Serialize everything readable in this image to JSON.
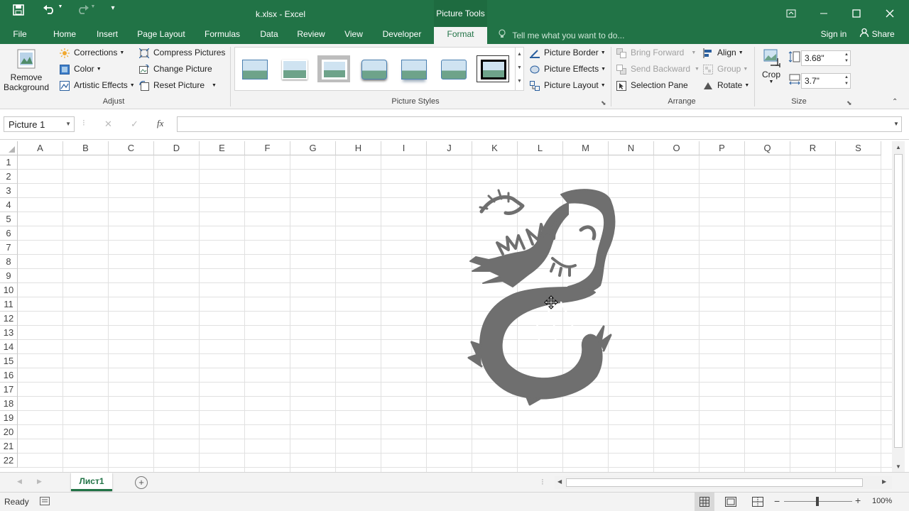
{
  "window": {
    "title": "k.xlsx - Excel",
    "context_tab_group": "Picture Tools",
    "undo_icon": "undo-icon",
    "redo_icon": "redo-icon"
  },
  "tabs": [
    "File",
    "Home",
    "Insert",
    "Page Layout",
    "Formulas",
    "Data",
    "Review",
    "View",
    "Developer",
    "Format"
  ],
  "active_tab": "Format",
  "tell_me": "Tell me what you want to do...",
  "sign_in": "Sign in",
  "share": "Share",
  "ribbon": {
    "remove_background": [
      "Remove",
      "Background"
    ],
    "corrections": "Corrections",
    "color": "Color",
    "artistic_effects": "Artistic Effects",
    "compress_pictures": "Compress Pictures",
    "change_picture": "Change Picture",
    "reset_picture": "Reset Picture",
    "adjust_label": "Adjust",
    "picture_styles_label": "Picture Styles",
    "picture_border": "Picture Border",
    "picture_effects": "Picture Effects",
    "picture_layout": "Picture Layout",
    "bring_forward": "Bring Forward",
    "send_backward": "Send Backward",
    "selection_pane": "Selection Pane",
    "align": "Align",
    "group": "Group",
    "rotate": "Rotate",
    "arrange_label": "Arrange",
    "crop": "Crop",
    "height": "3.68\"",
    "width": "3.7\"",
    "size_label": "Size"
  },
  "formula_bar": {
    "name_box": "Picture 1",
    "fx": "fx",
    "formula": ""
  },
  "columns": [
    "A",
    "B",
    "C",
    "D",
    "E",
    "F",
    "G",
    "H",
    "I",
    "J",
    "K",
    "L",
    "M",
    "N",
    "O",
    "P",
    "Q",
    "R",
    "S"
  ],
  "rows": [
    "1",
    "2",
    "3",
    "4",
    "5",
    "6",
    "7",
    "8",
    "9",
    "10",
    "11",
    "12",
    "13",
    "14",
    "15",
    "16",
    "17",
    "18",
    "19",
    "20",
    "21",
    "22"
  ],
  "sheet_tab": "Лист1",
  "status": {
    "ready": "Ready",
    "zoom": "100%"
  },
  "colors": {
    "excel_green": "#217346",
    "picture_gray": "#6f6f6f"
  }
}
